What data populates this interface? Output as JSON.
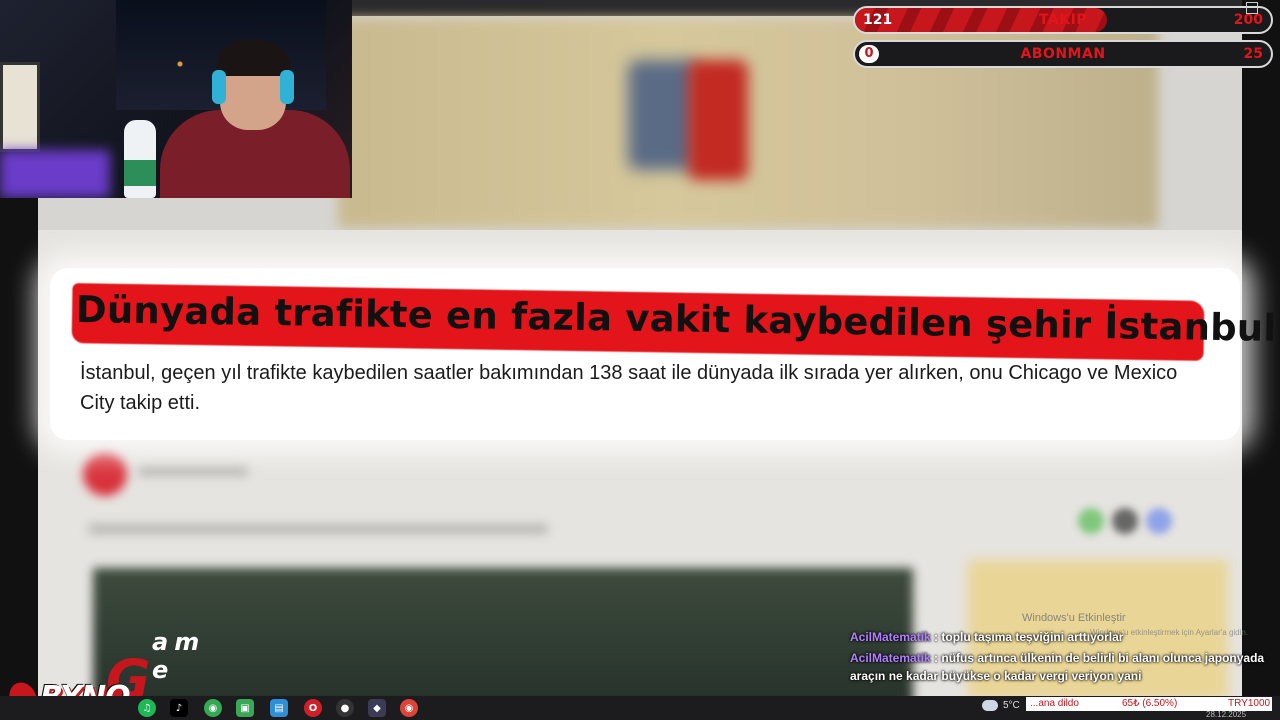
{
  "counters": {
    "follow": {
      "current": "121",
      "label": "TAKIP",
      "goal": "200",
      "progress": 0.605
    },
    "subscriber": {
      "current": "0",
      "label": "ABONMAN",
      "goal": "25",
      "progress": 0.0
    }
  },
  "article": {
    "headline": "Dünyada trafikte en fazla vakit kaybedilen şehir İstanbul oldu",
    "summary": "İstanbul, geçen yıl trafikte kaybedilen saatler bakımından 138 saat ile dünyada ilk sırada yer alırken, onu Chicago ve Mexico City takip etti."
  },
  "watermark": {
    "title": "Windows'u Etkinleştir",
    "subtitle": "Windows'u etkinleştirmek için Ayarlar'a gidin."
  },
  "chat": [
    {
      "user": "AcilMatematik",
      "text": "toplu taşıma teşviğini arttıyorlar"
    },
    {
      "user": "AcilMatematik",
      "text": "nüfus artınca ülkenin de belirli bi alanı olunca japonyada araçın ne kadar büyükse o kadar vergi veriyon yani"
    }
  ],
  "logo": {
    "primary": "BYNO",
    "g": "G",
    "rest": "am e"
  },
  "taskbar": {
    "icons": [
      "spotify-icon",
      "chrome-icon",
      "tiktok-icon",
      "chrome-profile-icon",
      "store-icon",
      "app-icon",
      "opera-icon",
      "obs-icon",
      "discord-icon",
      "chrome-alt-icon"
    ],
    "weather": "5°C",
    "ticker": {
      "left": "...ana dildo",
      "middle": "65₺ (6.50%)",
      "right": "TRY1000"
    },
    "date": "28.12.2025"
  },
  "colors": {
    "accent": "#e3141a",
    "chat_user": "#b080ff",
    "taskbar": "#1c1c1e"
  }
}
